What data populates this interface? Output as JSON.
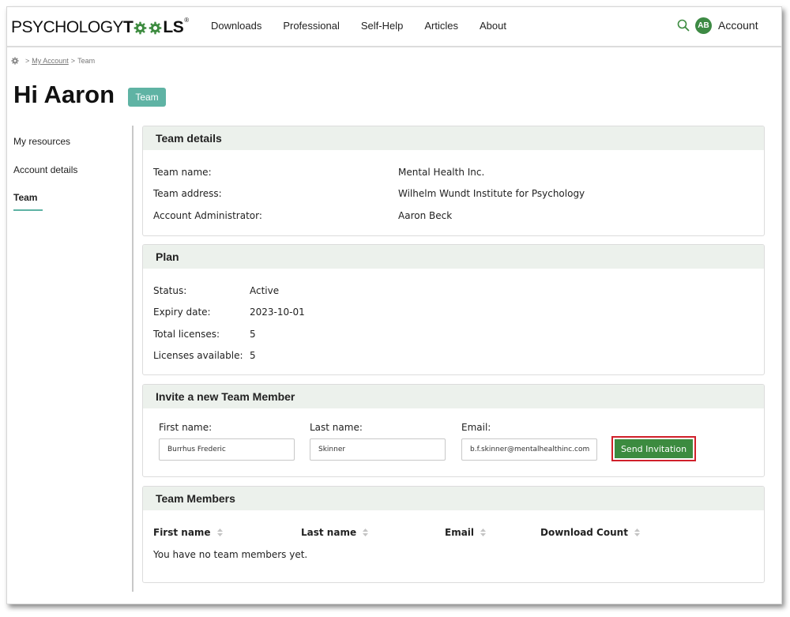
{
  "header": {
    "logo_pre": "PSYCHOLOGY",
    "logo_t": "T",
    "logo_ls": "LS",
    "logo_reg": "®",
    "nav": [
      "Downloads",
      "Professional",
      "Self-Help",
      "Articles",
      "About"
    ],
    "avatar_initials": "AB",
    "account_label": "Account"
  },
  "breadcrumb": {
    "sep1": ">",
    "my_account": "My Account",
    "sep2": ">",
    "current": "Team"
  },
  "page": {
    "title": "Hi Aaron",
    "badge": "Team"
  },
  "sidebar": {
    "items": [
      {
        "label": "My resources"
      },
      {
        "label": "Account details"
      },
      {
        "label": "Team"
      }
    ]
  },
  "team_details": {
    "heading": "Team details",
    "rows": [
      {
        "label": "Team name:",
        "value": "Mental Health Inc."
      },
      {
        "label": "Team address:",
        "value": "Wilhelm Wundt Institute for Psychology"
      },
      {
        "label": "Account Administrator:",
        "value": "Aaron Beck"
      }
    ]
  },
  "plan": {
    "heading": "Plan",
    "rows": [
      {
        "label": "Status:",
        "value": "Active"
      },
      {
        "label": "Expiry date:",
        "value": "2023-10-01"
      },
      {
        "label": "Total licenses:",
        "value": "5"
      },
      {
        "label": "Licenses available:",
        "value": "5"
      }
    ]
  },
  "invite": {
    "heading": "Invite a new Team Member",
    "first_name_label": "First name:",
    "first_name_value": "Burrhus Frederic",
    "last_name_label": "Last name:",
    "last_name_value": "Skinner",
    "email_label": "Email:",
    "email_value": "b.f.skinner@mentalhealthinc.com",
    "send_label": "Send Invitation"
  },
  "members": {
    "heading": "Team Members",
    "columns": [
      "First name",
      "Last name",
      "Email",
      "Download Count"
    ],
    "empty_message": "You have no team members yet."
  },
  "colors": {
    "brand_green": "#3c8b3f",
    "teal_accent": "#5fb3a4",
    "panel_header_bg": "#ecf1ec",
    "highlight_border": "#d0202a"
  }
}
